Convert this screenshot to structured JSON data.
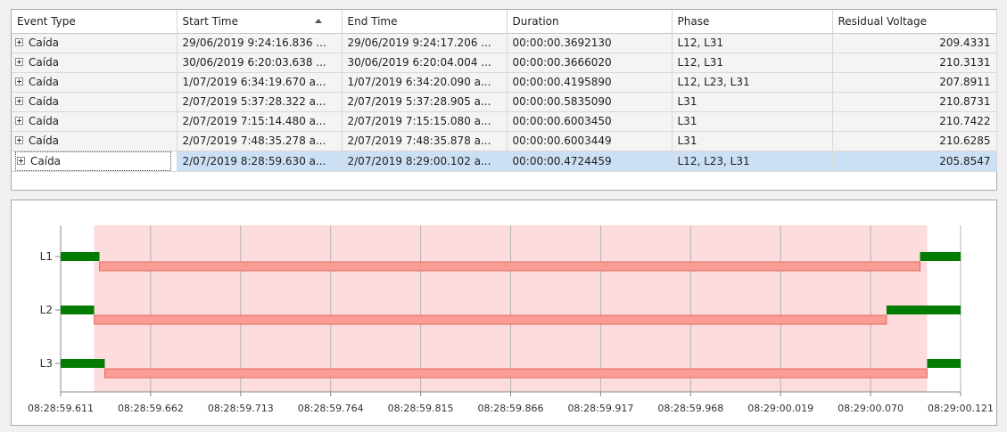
{
  "grid": {
    "columns": [
      "Event Type",
      "Start Time",
      "End Time",
      "Duration",
      "Phase",
      "Residual Voltage"
    ],
    "rows": [
      {
        "event_type": "Caída",
        "start": "29/06/2019 9:24:16.836 ...",
        "end": "29/06/2019 9:24:17.206 ...",
        "duration": "00:00:00.3692130",
        "phase": "L12, L31",
        "residual": "209.4331"
      },
      {
        "event_type": "Caída",
        "start": "30/06/2019 6:20:03.638 ...",
        "end": "30/06/2019 6:20:04.004 ...",
        "duration": "00:00:00.3666020",
        "phase": "L12, L31",
        "residual": "210.3131"
      },
      {
        "event_type": "Caída",
        "start": "1/07/2019 6:34:19.670 a...",
        "end": "1/07/2019 6:34:20.090 a...",
        "duration": "00:00:00.4195890",
        "phase": "L12, L23, L31",
        "residual": "207.8911"
      },
      {
        "event_type": "Caída",
        "start": "2/07/2019 5:37:28.322 a...",
        "end": "2/07/2019 5:37:28.905 a...",
        "duration": "00:00:00.5835090",
        "phase": "L31",
        "residual": "210.8731"
      },
      {
        "event_type": "Caída",
        "start": "2/07/2019 7:15:14.480 a...",
        "end": "2/07/2019 7:15:15.080 a...",
        "duration": "00:00:00.6003450",
        "phase": "L31",
        "residual": "210.7422"
      },
      {
        "event_type": "Caída",
        "start": "2/07/2019 7:48:35.278 a...",
        "end": "2/07/2019 7:48:35.878 a...",
        "duration": "00:00:00.6003449",
        "phase": "L31",
        "residual": "210.6285"
      },
      {
        "event_type": "Caída",
        "start": "2/07/2019 8:28:59.630 a...",
        "end": "2/07/2019 8:29:00.102 a...",
        "duration": "00:00:00.4724459",
        "phase": "L12, L23, L31",
        "residual": "205.8547",
        "selected": true
      }
    ]
  },
  "timeline": {
    "type": "timeline",
    "x_tick_labels": [
      "08:28:59.611",
      "08:28:59.662",
      "08:28:59.713",
      "08:28:59.764",
      "08:28:59.815",
      "08:28:59.866",
      "08:28:59.917",
      "08:28:59.968",
      "08:29:00.019",
      "08:29:00.070",
      "08:29:00.121"
    ],
    "x_range_seconds": [
      59.611,
      60.121
    ],
    "event_window": [
      59.63,
      60.102
    ],
    "lanes": [
      {
        "label": "L1",
        "sag": [
          59.633,
          60.098
        ]
      },
      {
        "label": "L2",
        "sag": [
          59.63,
          60.079
        ]
      },
      {
        "label": "L3",
        "sag": [
          59.636,
          60.102
        ]
      }
    ],
    "colors": {
      "normal": "#037c03",
      "sag_fill": "#fa9d94",
      "sag_stroke": "#e06a60",
      "window": "#fcdcdd",
      "grid": "#b4b4b4"
    }
  }
}
